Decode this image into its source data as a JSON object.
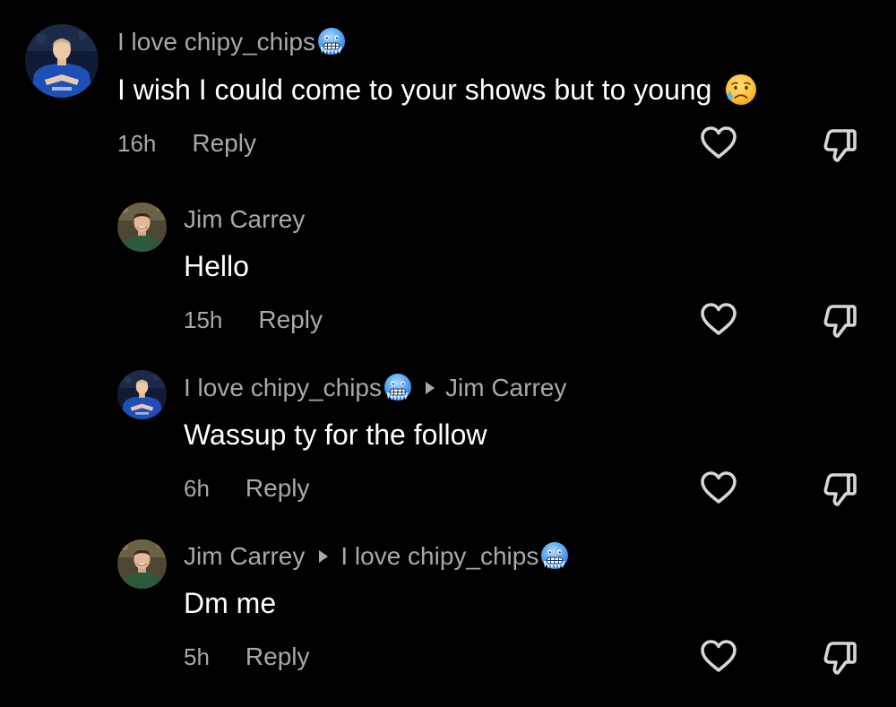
{
  "comments": [
    {
      "author": "I love chipy_chips",
      "author_emoji": "freezing-face-emoji",
      "text": "I wish I could come to your shows but to young",
      "text_emoji": "sad-relieved-face-emoji",
      "time": "16h",
      "reply_label": "Reply"
    },
    {
      "author": "Jim Carrey",
      "text": "Hello",
      "time": "15h",
      "reply_label": "Reply"
    },
    {
      "author": "I love chipy_chips",
      "author_emoji": "freezing-face-emoji",
      "reply_to": "Jim Carrey",
      "text": "Wassup ty for the follow",
      "time": "6h",
      "reply_label": "Reply"
    },
    {
      "author": "Jim Carrey",
      "reply_to": "I love chipy_chips",
      "reply_to_emoji": "freezing-face-emoji",
      "text": "Dm me",
      "time": "5h",
      "reply_label": "Reply"
    }
  ],
  "icons": {
    "like": "heart-outline-icon",
    "dislike": "thumbs-down-outline-icon",
    "reply_arrow": "triangle-right-icon"
  },
  "colors": {
    "background": "#000000",
    "primary_text": "#ffffff",
    "secondary_text": "#a8a8a8",
    "icon_stroke": "#d6d6d6"
  }
}
